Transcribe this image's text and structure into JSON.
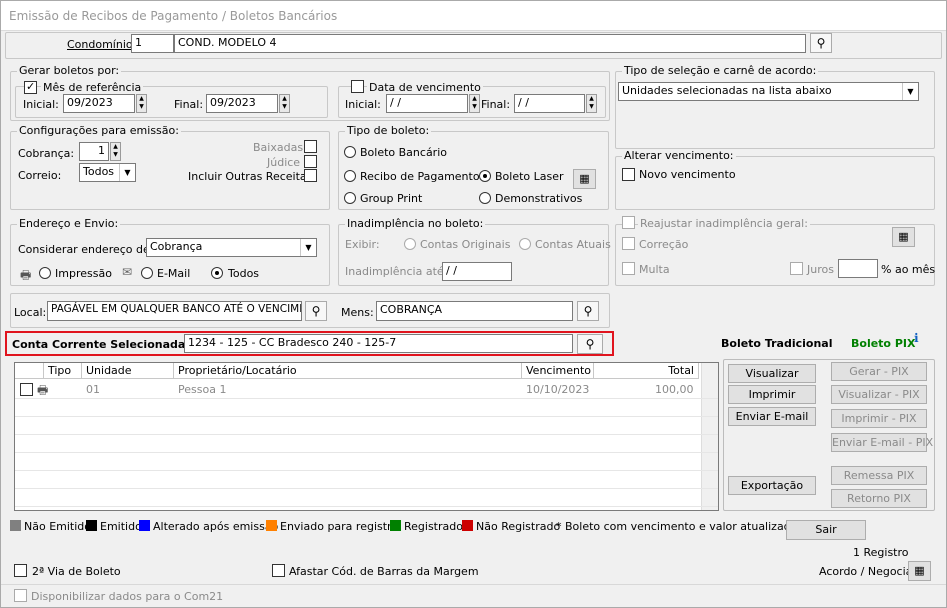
{
  "window_title": "Emissão de Recibos de Pagamento / Boletos Bancários",
  "condominio": {
    "label": "Condomínio:",
    "code": "1",
    "name": "COND. MODELO 4"
  },
  "gerar": {
    "title": "Gerar boletos por:",
    "mes_ref_label": "Mês de referência",
    "inicial_label": "Inicial:",
    "inicial": "09/2023",
    "final_label": "Final:",
    "final": "09/2023",
    "data_venc_label": "Data de vencimento",
    "dv_inicial": " / /",
    "dv_final": " / /"
  },
  "tipo_selecao": {
    "title": "Tipo de seleção e carnê de acordo:",
    "value": "Unidades selecionadas na lista abaixo"
  },
  "config": {
    "title": "Configurações para emissão:",
    "cobranca_label": "Cobrança:",
    "cobranca": "1",
    "correio_label": "Correio:",
    "correio": "Todos",
    "baixadas": "Baixadas",
    "judice": "Júdice",
    "outras": "Incluir Outras Receitas"
  },
  "tipo_boleto": {
    "title": "Tipo de boleto:",
    "bancario": "Boleto Bancário",
    "recibo": "Recibo de Pagamento",
    "laser": "Boleto Laser",
    "group": "Group Print",
    "demonstrativos": "Demonstrativos"
  },
  "alterar_venc": {
    "title": "Alterar vencimento:",
    "novo": "Novo vencimento"
  },
  "endereco": {
    "title": "Endereço e Envio:",
    "considerar_label": "Considerar endereço de:",
    "considerar": "Cobrança",
    "impressao": "Impressão",
    "email": "E-Mail",
    "todos": "Todos"
  },
  "inadimplencia": {
    "title": "Inadimplência no boleto:",
    "exibir_label": "Exibir:",
    "originais": "Contas Originais",
    "atuais": "Contas Atuais",
    "ate_label": "Inadimplência até:",
    "ate": " / /"
  },
  "reajustar": {
    "title": "Reajustar inadimplência geral:",
    "correcao": "Correção",
    "multa": "Multa",
    "juros": "Juros",
    "ao_mes": "% ao mês"
  },
  "local": {
    "label": "Local:",
    "value": "PAGÁVEL EM QUALQUER BANCO ATÉ O VENCIMENTO"
  },
  "mens": {
    "label": "Mens:",
    "value": "COBRANÇA"
  },
  "conta": {
    "label": "Conta Corrente Selecionada:",
    "value": "1234 - 125 - CC Bradesco 240 - 125-7"
  },
  "boleto_tradicional": "Boleto Tradicional",
  "boleto_pix": "Boleto PIX",
  "grid": {
    "headers": [
      "Tipo",
      "Unidade",
      "Proprietário/Locatário",
      "Vencimento",
      "Total"
    ],
    "rows": [
      {
        "unidade": "01",
        "prop": "Pessoa 1",
        "venc": "10/10/2023",
        "total": "100,00"
      }
    ]
  },
  "buttons": {
    "visualizar": "Visualizar",
    "imprimir": "Imprimir",
    "enviar": "Enviar E-mail",
    "exportacao": "Exportação",
    "gerar_pix": "Gerar - PIX",
    "vis_pix": "Visualizar - PIX",
    "imp_pix": "Imprimir - PIX",
    "env_pix": "Enviar E-mail - PIX",
    "remessa": "Remessa PIX",
    "retorno": "Retorno PIX",
    "sair": "Sair"
  },
  "legend": [
    {
      "label": "Não Emitido",
      "color": "#808080"
    },
    {
      "label": "Emitido",
      "color": "#000000"
    },
    {
      "label": "Alterado após emissão",
      "color": "#0000ff"
    },
    {
      "label": "Enviado para registro",
      "color": "#ff8000"
    },
    {
      "label": "Registrado",
      "color": "#008000"
    },
    {
      "label": "Não Registrado",
      "color": "#cc0000"
    }
  ],
  "legend_note": "* Boleto com vencimento e valor atualizados.",
  "registro_count": "1 Registro",
  "segunda_via": "2ª Via de Boleto",
  "afastar": "Afastar Cód. de Barras da Margem",
  "acordo": "Acordo / Negociar",
  "disponibilizar": "Disponibilizar dados para o Com21"
}
